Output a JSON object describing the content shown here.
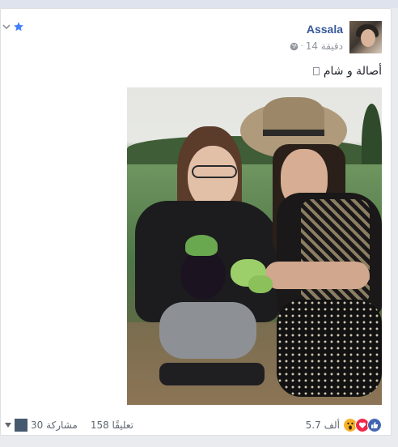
{
  "post": {
    "author": "Assala",
    "time": "14 دقيقة",
    "meta_separator": "·",
    "text": "أصالة و شام",
    "text_trailing_glyph": "□"
  },
  "footer": {
    "reactions_count": "5.7 ألف",
    "comments": "158 تعليقًا",
    "shares": "30 مشاركة"
  },
  "icons": {
    "options_chevron": "chevron-down-icon",
    "favorite": "star-icon",
    "privacy": "globe-icon",
    "reactions": [
      "like-icon",
      "love-icon",
      "wow-icon"
    ],
    "share_audience": "avatar-icon",
    "share_menu": "caret-down-icon"
  },
  "colors": {
    "author_link": "#365899",
    "meta_text": "#90949c",
    "post_text": "#1d2129",
    "footer_text": "#606770",
    "like": "#4267b2",
    "love": "#f0284a",
    "wow": "#f7b125",
    "star": "#4080ff"
  }
}
